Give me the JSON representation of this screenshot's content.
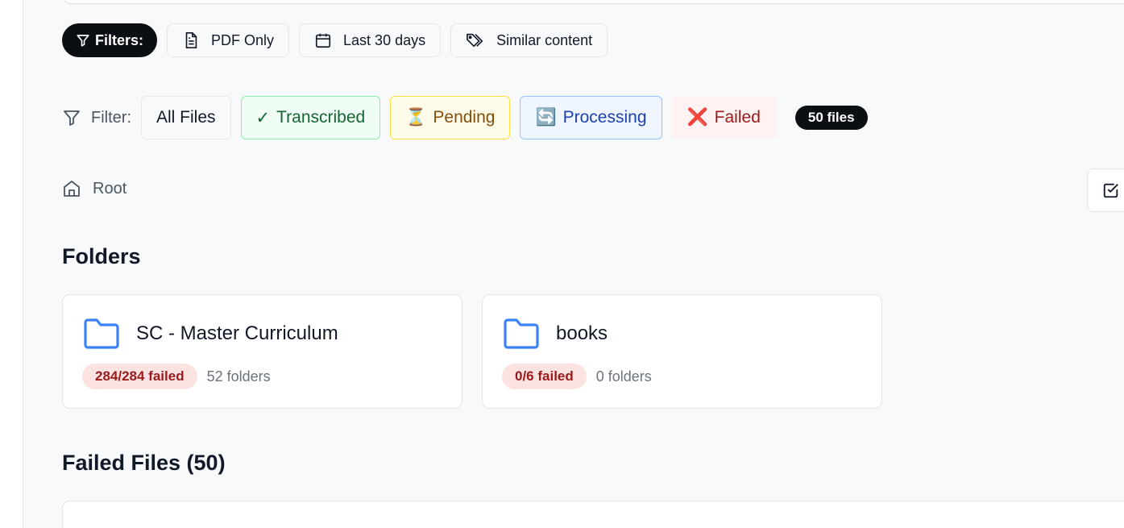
{
  "quick_filters": {
    "active_label": "Filters:",
    "items": [
      {
        "label": "PDF Only",
        "icon": "file-text-icon"
      },
      {
        "label": "Last 30 days",
        "icon": "calendar-icon"
      },
      {
        "label": "Similar content",
        "icon": "tags-icon"
      }
    ]
  },
  "status_filter": {
    "label": "Filter:",
    "options": [
      {
        "label": "All Files"
      },
      {
        "emoji": "✓",
        "label": "Transcribed"
      },
      {
        "emoji": "⏳",
        "label": "Pending"
      },
      {
        "emoji": "🔄",
        "label": "Processing"
      },
      {
        "emoji": "❌",
        "label": "Failed"
      }
    ],
    "count_badge": "50 files"
  },
  "breadcrumb": {
    "root_label": "Root"
  },
  "folders_section": {
    "title": "Folders",
    "folders": [
      {
        "name": "SC - Master Curriculum",
        "status": "284/284 failed",
        "subfolders": "52 folders"
      },
      {
        "name": "books",
        "status": "0/6 failed",
        "subfolders": "0 folders"
      }
    ]
  },
  "failed_files_section": {
    "title": "Failed Files (50)"
  },
  "colors": {
    "accent_dark": "#0b0f14",
    "folder_blue": "#3b82f6",
    "failed_red": "#991b1b",
    "failed_bg": "#fde2e2"
  }
}
